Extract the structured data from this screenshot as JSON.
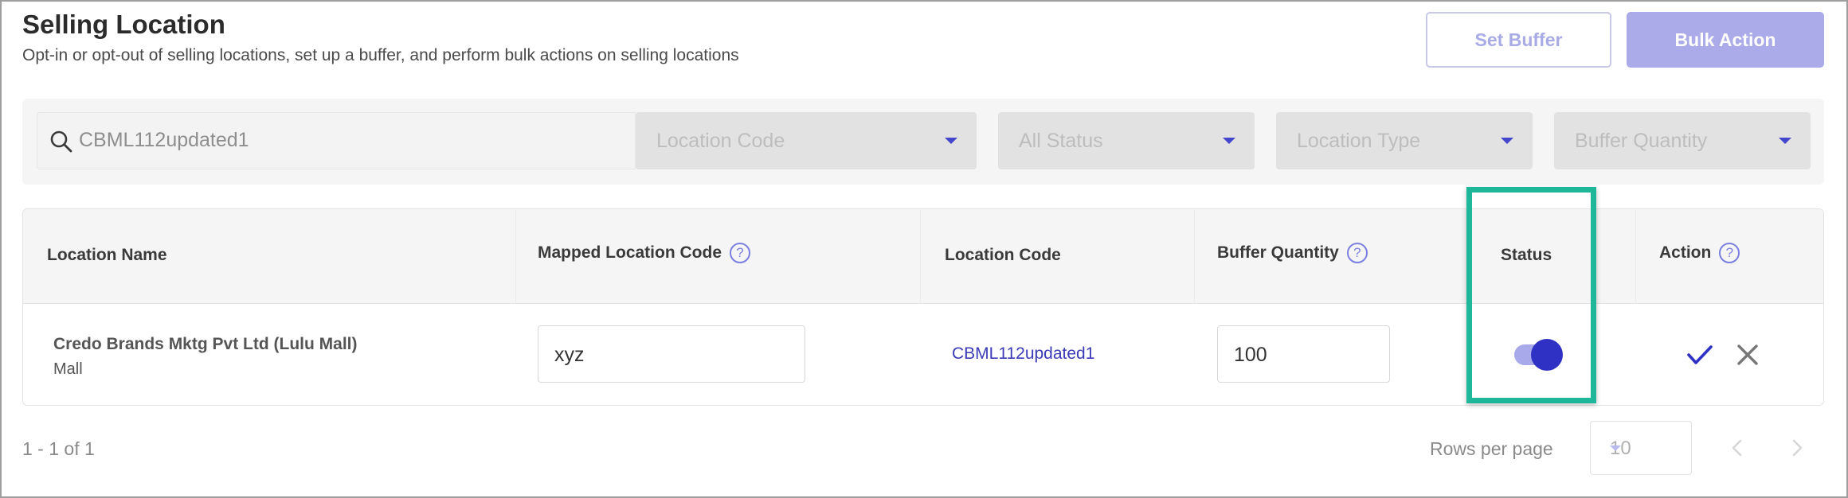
{
  "header": {
    "title": "Selling Location",
    "subtitle": "Opt-in or opt-out of selling locations, set up a buffer, and perform bulk actions on selling locations",
    "set_buffer_label": "Set Buffer",
    "bulk_action_label": "Bulk Action"
  },
  "filters": {
    "search_value": "CBML112updated1",
    "location_code": "Location Code",
    "status": "All Status",
    "location_type": "Location Type",
    "buffer_quantity": "Buffer Quantity"
  },
  "table": {
    "columns": {
      "location_name": "Location Name",
      "mapped_location_code": "Mapped Location Code",
      "location_code": "Location Code",
      "buffer_quantity": "Buffer Quantity",
      "status": "Status",
      "action": "Action"
    },
    "help_glyph": "?",
    "rows": [
      {
        "location_name": "Credo Brands Mktg Pvt Ltd (Lulu Mall)",
        "location_type": "Mall",
        "mapped_location_code": "xyz",
        "location_code": "CBML112updated1",
        "buffer_quantity": "100",
        "status_enabled": true
      }
    ]
  },
  "footer": {
    "count": "1 - 1 of 1",
    "rows_per_page_label": "Rows per page",
    "rows_per_page_value": "10"
  },
  "colors": {
    "accent": "#2f31c4",
    "accent_light": "#aaabe8",
    "highlight": "#1fb79a"
  }
}
